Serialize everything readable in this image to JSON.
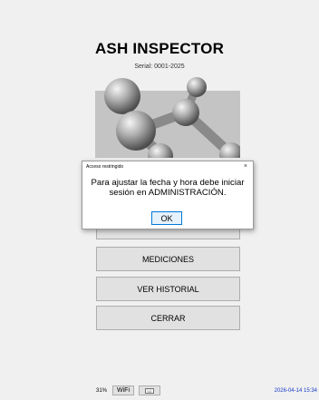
{
  "app": {
    "title": "ASH INSPECTOR",
    "serial": "Serial: 0001-2025"
  },
  "menu": {
    "hidden_label": "ADMINISTRACIÓN",
    "items": [
      {
        "label": "MEDICIONES"
      },
      {
        "label": "VER HISTORIAL"
      },
      {
        "label": "CERRAR"
      }
    ]
  },
  "dialog": {
    "title": "Acceso restringido",
    "close_symbol": "×",
    "message": "Para ajustar la fecha y hora debe iniciar sesión en ADMINISTRACIÓN.",
    "ok_label": "OK"
  },
  "status_bar": {
    "battery": "31%",
    "wifi_label": "WiFi",
    "keyboard_icon": "keyboard-icon",
    "datetime": "2026-04-14  15:34"
  },
  "colors": {
    "background": "#f0f0f0",
    "button_bg": "#e1e1e1",
    "button_border": "#adadad",
    "accent": "#0078d7",
    "datetime_text": "#1a3cc8"
  }
}
